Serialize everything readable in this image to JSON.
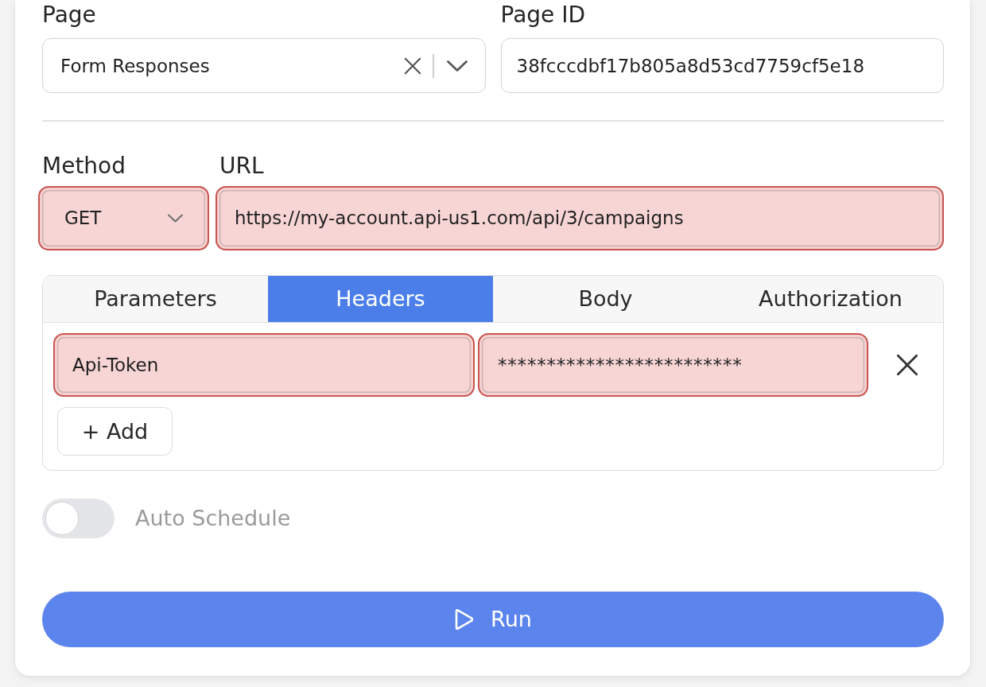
{
  "page_select": {
    "label": "Page",
    "value": "Form Responses"
  },
  "page_id": {
    "label": "Page ID",
    "value": "38fcccdbf17b805a8d53cd7759cf5e18"
  },
  "method": {
    "label": "Method",
    "value": "GET",
    "invalid": true
  },
  "url": {
    "label": "URL",
    "value": "https://my-account.api-us1.com/api/3/campaigns",
    "invalid": true
  },
  "tabs": [
    {
      "label": "Parameters",
      "selected": false
    },
    {
      "label": "Headers",
      "selected": true
    },
    {
      "label": "Body",
      "selected": false
    },
    {
      "label": "Authorization",
      "selected": false
    }
  ],
  "headers": [
    {
      "key": "Api-Token",
      "value": "*************************",
      "invalid": true
    }
  ],
  "add_button": "+ Add",
  "auto_schedule": {
    "label": "Auto Schedule",
    "on": false
  },
  "run_button": "Run"
}
